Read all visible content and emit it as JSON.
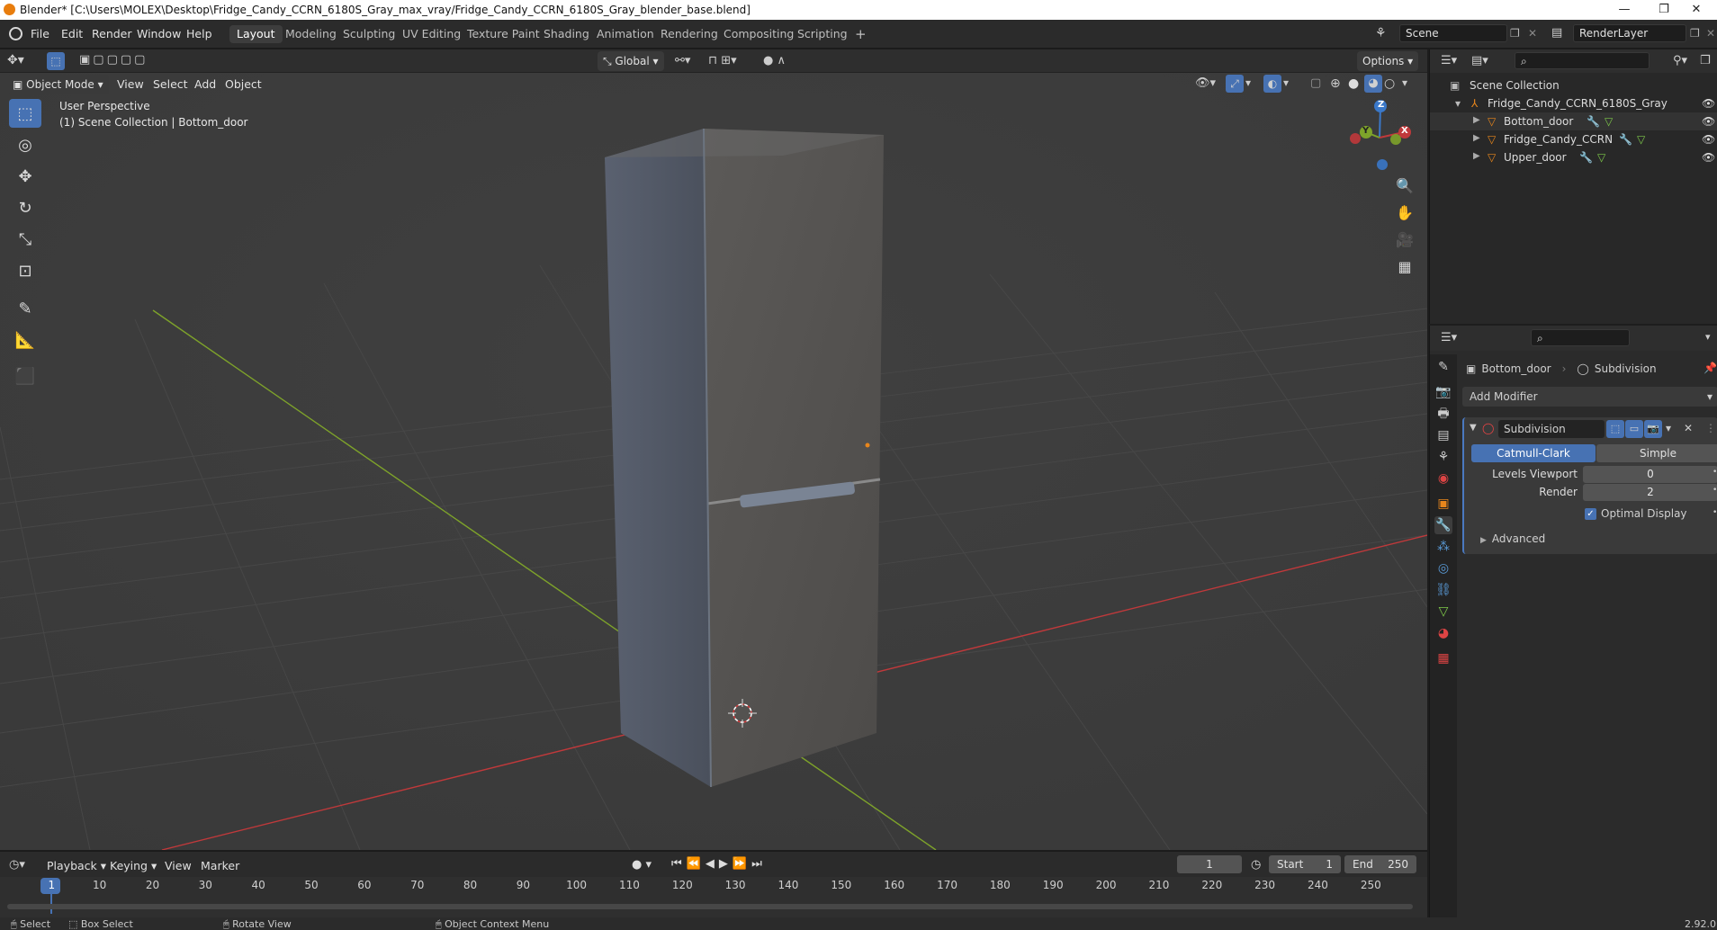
{
  "window": {
    "title": "Blender* [C:\\Users\\MOLEX\\Desktop\\Fridge_Candy_CCRN_6180S_Gray_max_vray/Fridge_Candy_CCRN_6180S_Gray_blender_base.blend]",
    "minimize": "—",
    "restore": "❐",
    "close": "✕"
  },
  "menu": {
    "file": "File",
    "edit": "Edit",
    "render": "Render",
    "window": "Window",
    "help": "Help"
  },
  "workspaces": [
    "Layout",
    "Modeling",
    "Sculpting",
    "UV Editing",
    "Texture Paint",
    "Shading",
    "Animation",
    "Rendering",
    "Compositing",
    "Scripting"
  ],
  "workspace_add": "+",
  "scene": {
    "name": "Scene",
    "render_layer": "RenderLayer"
  },
  "toolbar": {
    "orientation": "Global",
    "options": "Options"
  },
  "viewport": {
    "mode": "Object Mode",
    "menus": [
      "View",
      "Select",
      "Add",
      "Object"
    ],
    "info_line1": "User Perspective",
    "info_line2": "(1) Scene Collection | Bottom_door",
    "gizmo": {
      "x": "X",
      "y": "Y",
      "z": "Z"
    }
  },
  "outliner": {
    "root": "Scene Collection",
    "collection": "Fridge_Candy_CCRN_6180S_Gray",
    "objects": [
      "Bottom_door",
      "Fridge_Candy_CCRN",
      "Upper_door"
    ]
  },
  "properties": {
    "object_name": "Bottom_door",
    "modifier_breadcrumb": "Subdivision",
    "add_modifier": "Add Modifier",
    "modifier": {
      "name": "Subdivision",
      "type_catmull": "Catmull-Clark",
      "type_simple": "Simple",
      "levels_viewport_label": "Levels Viewport",
      "levels_viewport": "0",
      "render_label": "Render",
      "render": "2",
      "optimal_display": "Optimal Display",
      "optimal_display_checked": true,
      "advanced": "Advanced"
    }
  },
  "timeline": {
    "menus": [
      "Playback",
      "Keying",
      "View",
      "Marker"
    ],
    "current_frame": "1",
    "start_label": "Start",
    "start": "1",
    "end_label": "End",
    "end": "250",
    "ticks": [
      "1",
      "10",
      "20",
      "30",
      "40",
      "50",
      "60",
      "70",
      "80",
      "90",
      "100",
      "110",
      "120",
      "130",
      "140",
      "150",
      "160",
      "170",
      "180",
      "190",
      "200",
      "210",
      "220",
      "230",
      "240",
      "250"
    ]
  },
  "statusbar": {
    "select": "Select",
    "box_select": "Box Select",
    "rotate_view": "Rotate View",
    "context_menu": "Object Context Menu",
    "version": "2.92.0"
  },
  "colors": {
    "accent": "#4772b3",
    "x_axis": "#c0393b",
    "y_axis": "#7ea32a",
    "z_axis": "#3a78c9",
    "object_orange": "#e8861c"
  }
}
